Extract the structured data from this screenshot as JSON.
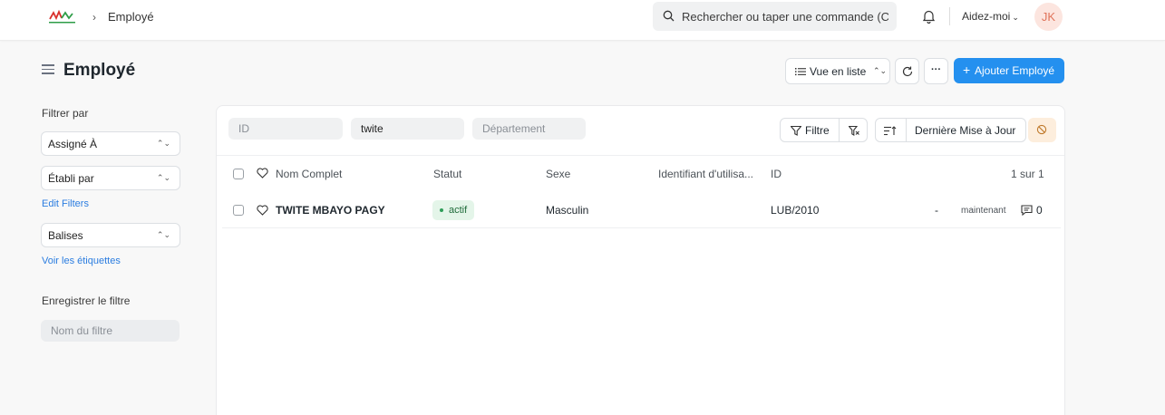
{
  "navbar": {
    "breadcrumb": "Employé",
    "breadcrumb_sep": "›",
    "search_placeholder": "Rechercher ou taper une commande (Ctrl + G)",
    "help_label": "Aidez-moi",
    "avatar_initials": "JK",
    "accent_logo_colors": [
      "#d9302c",
      "#2e9d47"
    ]
  },
  "page": {
    "title": "Employé",
    "view_label": "Vue en liste",
    "more_label": "···",
    "add_button": "Ajouter Employé"
  },
  "sidebar": {
    "filter_by": "Filtrer par",
    "assigned_to": "Assigné À",
    "created_by": "Établi par",
    "edit_filters": "Edit Filters",
    "tags": "Balises",
    "show_tags": "Voir les étiquettes",
    "save_filter": "Enregistrer le filtre",
    "filter_name_placeholder": "Nom du filtre"
  },
  "list": {
    "filters": {
      "id_placeholder": "ID",
      "name_value": "twite",
      "department_placeholder": "Département"
    },
    "filter_button": "Filtre",
    "sort_label": "Dernière Mise à Jour",
    "columns": {
      "name": "Nom Complet",
      "status": "Statut",
      "gender": "Sexe",
      "user_id": "Identifiant d'utilisa...",
      "id": "ID",
      "count": "1 sur 1"
    },
    "rows": [
      {
        "name": "TWITE MBAYO PAGY",
        "status": "actif",
        "gender": "Masculin",
        "id": "LUB/2010",
        "dash": "-",
        "modified": "maintenant",
        "comments": "0"
      }
    ]
  }
}
